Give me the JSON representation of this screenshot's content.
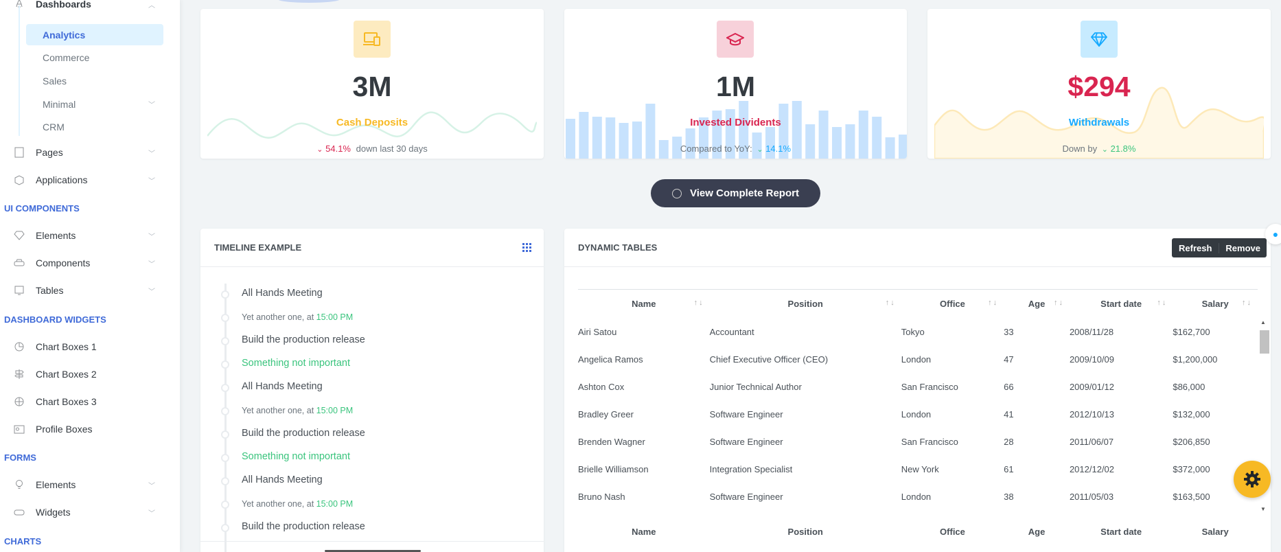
{
  "sidebar": {
    "dashboards": {
      "label": "Dashboards",
      "children": [
        "Analytics",
        "Commerce",
        "Sales",
        "Minimal",
        "CRM"
      ]
    },
    "pages": "Pages",
    "applications": "Applications",
    "headings": {
      "ui": "UI COMPONENTS",
      "widgets": "DASHBOARD WIDGETS",
      "forms": "FORMS",
      "charts": "CHARTS"
    },
    "ui_items": [
      "Elements",
      "Components",
      "Tables"
    ],
    "widget_items": [
      "Chart Boxes 1",
      "Chart Boxes 2",
      "Chart Boxes 3",
      "Profile Boxes"
    ],
    "form_items": [
      "Elements",
      "Widgets"
    ]
  },
  "stats": [
    {
      "value": "3M",
      "label": "Cash Deposits",
      "pct": "54.1%",
      "note": "down last 30 days",
      "color": "#f7b924",
      "icon": "devices-icon"
    },
    {
      "value": "1M",
      "label": "Invested Dividents",
      "prefix": "Compared to YoY:",
      "pct": "14.1%",
      "color": "#d92550",
      "icon": "graduation-cap-icon"
    },
    {
      "value": "$294",
      "label": "Withdrawals",
      "prefix": "Down by",
      "pct": "21.8%",
      "color": "#16aaff",
      "icon": "diamond-icon"
    }
  ],
  "report_button": "View Complete Report",
  "timeline": {
    "title": "TIMELINE EXAMPLE",
    "items": [
      {
        "text": "All Hands Meeting",
        "type": "title"
      },
      {
        "text": "Yet another one, at ",
        "time": "15:00 PM",
        "type": "meta"
      },
      {
        "text": "Build the production release",
        "type": "title"
      },
      {
        "text": "Something not important",
        "type": "success"
      },
      {
        "text": "All Hands Meeting",
        "type": "title"
      },
      {
        "text": "Yet another one, at ",
        "time": "15:00 PM",
        "type": "meta"
      },
      {
        "text": "Build the production release",
        "type": "title"
      },
      {
        "text": "Something not important",
        "type": "success"
      },
      {
        "text": "All Hands Meeting",
        "type": "title"
      },
      {
        "text": "Yet another one, at ",
        "time": "15:00 PM",
        "type": "meta"
      },
      {
        "text": "Build the production release",
        "type": "title"
      }
    ]
  },
  "table": {
    "title": "DYNAMIC TABLES",
    "refresh": "Refresh",
    "remove": "Remove",
    "columns": [
      "Name",
      "Position",
      "Office",
      "Age",
      "Start date",
      "Salary"
    ],
    "rows": [
      [
        "Airi Satou",
        "Accountant",
        "Tokyo",
        "33",
        "2008/11/28",
        "$162,700"
      ],
      [
        "Angelica Ramos",
        "Chief Executive Officer (CEO)",
        "London",
        "47",
        "2009/10/09",
        "$1,200,000"
      ],
      [
        "Ashton Cox",
        "Junior Technical Author",
        "San Francisco",
        "66",
        "2009/01/12",
        "$86,000"
      ],
      [
        "Bradley Greer",
        "Software Engineer",
        "London",
        "41",
        "2012/10/13",
        "$132,000"
      ],
      [
        "Brenden Wagner",
        "Software Engineer",
        "San Francisco",
        "28",
        "2011/06/07",
        "$206,850"
      ],
      [
        "Brielle Williamson",
        "Integration Specialist",
        "New York",
        "61",
        "2012/12/02",
        "$372,000"
      ],
      [
        "Bruno Nash",
        "Software Engineer",
        "London",
        "38",
        "2011/05/03",
        "$163,500"
      ]
    ]
  },
  "colors": {
    "primary": "#3f6ad8",
    "success": "#3ac47d",
    "warning": "#f7b924",
    "danger": "#d92550",
    "info": "#16aaff"
  }
}
